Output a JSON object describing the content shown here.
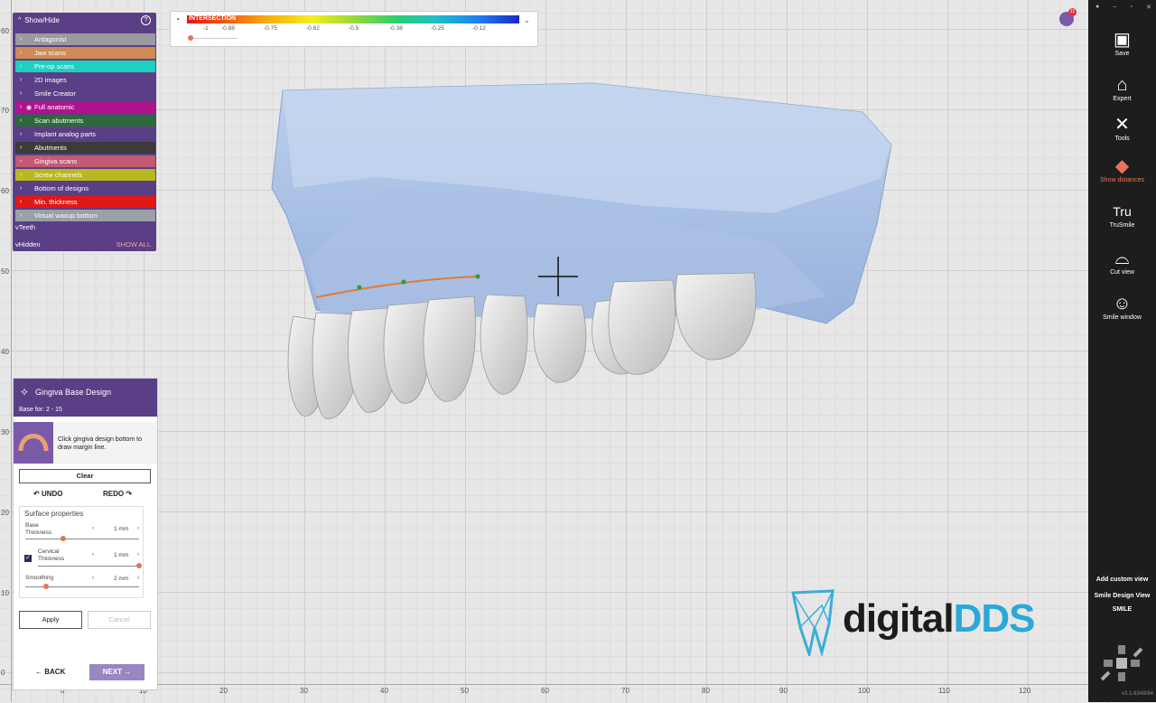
{
  "ruler": {
    "left_ticks": [
      "60",
      "70",
      "60",
      "50",
      "40",
      "30",
      "20",
      "10",
      "0"
    ],
    "bottom_ticks": [
      "0",
      "10",
      "20",
      "30",
      "40",
      "50",
      "60",
      "70",
      "80",
      "90",
      "100",
      "110",
      "120"
    ]
  },
  "show_hide": {
    "title": "Show/Hide",
    "help": "?",
    "layers": [
      {
        "label": "Antagonist",
        "color": "#9a9aa0",
        "eye": false
      },
      {
        "label": "Jaw scans",
        "color": "#d08a55",
        "eye": false
      },
      {
        "label": "Pre-op scans",
        "color": "#1ed0c0",
        "eye": false
      },
      {
        "label": "2D images",
        "color": "#5a3f86",
        "eye": false
      },
      {
        "label": "Smile Creator",
        "color": "#5a3f86",
        "eye": false
      },
      {
        "label": "Full anatomic",
        "color": "#b0148c",
        "eye": true
      },
      {
        "label": "Scan abutments",
        "color": "#2d6a3a",
        "eye": false
      },
      {
        "label": "Implant analog parts",
        "color": "#5a3f86",
        "eye": false
      },
      {
        "label": "Abutments",
        "color": "#3b3b3b",
        "eye": false
      },
      {
        "label": "Gingiva scans",
        "color": "#c25a72",
        "eye": false
      },
      {
        "label": "Screw channels",
        "color": "#b8b820",
        "eye": false
      },
      {
        "label": "Bottom of designs",
        "color": "#5a3f86",
        "eye": false
      },
      {
        "label": "Min. thickness",
        "color": "#e01818",
        "eye": false
      },
      {
        "label": "Virtual waxup bottom",
        "color": "#9aa0a8",
        "eye": false
      }
    ],
    "teeth_label": "Teeth",
    "hidden_label": "Hidden",
    "show_all": "SHOW ALL"
  },
  "intersection": {
    "title": "INTERSECTION",
    "scale": [
      "-1",
      "-0.88",
      "-0.75",
      "-0.62",
      "-0.5",
      "-0.38",
      "-0.25",
      "-0.12"
    ]
  },
  "notifications": {
    "count": "11"
  },
  "toolbar": {
    "save": "Save",
    "expert": "Expert",
    "tools": "Tools",
    "show_distances": "Show distances",
    "trusmile": "TruSmile",
    "trusmile_glyph": "Tru",
    "cut_view": "Cut view",
    "smile_window": "Smile window",
    "add_custom_view": "Add custom view",
    "smile_design_view": "Smile Design View",
    "smile": "SMILE",
    "version": "v3.1-8349/64"
  },
  "gingiva": {
    "title": "Gingiva Base Design",
    "subtitle": "Base for: 2 - 15",
    "hint": "Click gingiva design bottom to draw margin line.",
    "clear": "Clear",
    "undo": "UNDO",
    "redo": "REDO",
    "surface_title": "Surface properties",
    "base_thickness_label_1": "Base",
    "base_thickness_label_2": "Thickness",
    "base_thickness_value": "1 mm",
    "base_thickness_level": 0.33,
    "cervical_label_1": "Cervical",
    "cervical_label_2": "Thickness",
    "cervical_value": "1 mm",
    "cervical_level": 1.0,
    "smoothing_label": "Smoothing",
    "smoothing_value": "2 mm",
    "smoothing_level": 0.18,
    "apply": "Apply",
    "cancel": "Cancel",
    "back": "BACK",
    "next": "NEXT"
  },
  "watermark": {
    "text_digital": "digital",
    "text_dds": "DDS"
  }
}
